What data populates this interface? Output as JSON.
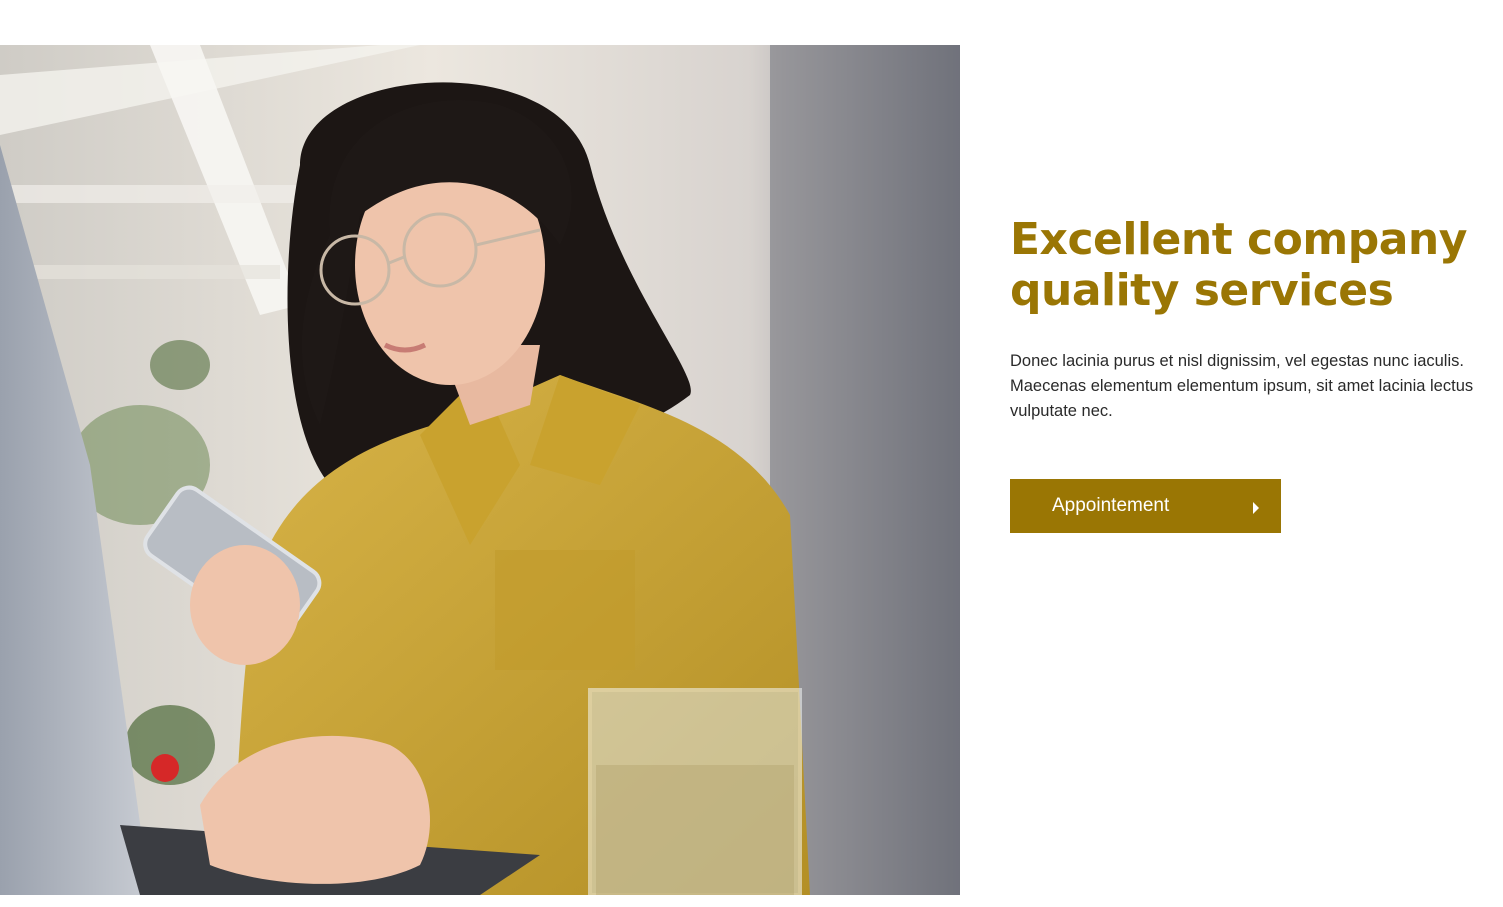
{
  "hero": {
    "image_icon": "photo-woman-with-phone"
  },
  "content": {
    "headline_line1": "Excellent company",
    "headline_line2": "quality services",
    "description": "Donec lacinia purus et nisl dignissim, vel egestas nunc iaculis. Maecenas elementum elementum ipsum, sit amet lacinia lectus vulputate nec.",
    "button_label": "Appointement",
    "button_icon": "caret-right-icon"
  },
  "colors": {
    "accent": "#9a7604",
    "text": "#2a2a2a",
    "background": "#ffffff"
  }
}
